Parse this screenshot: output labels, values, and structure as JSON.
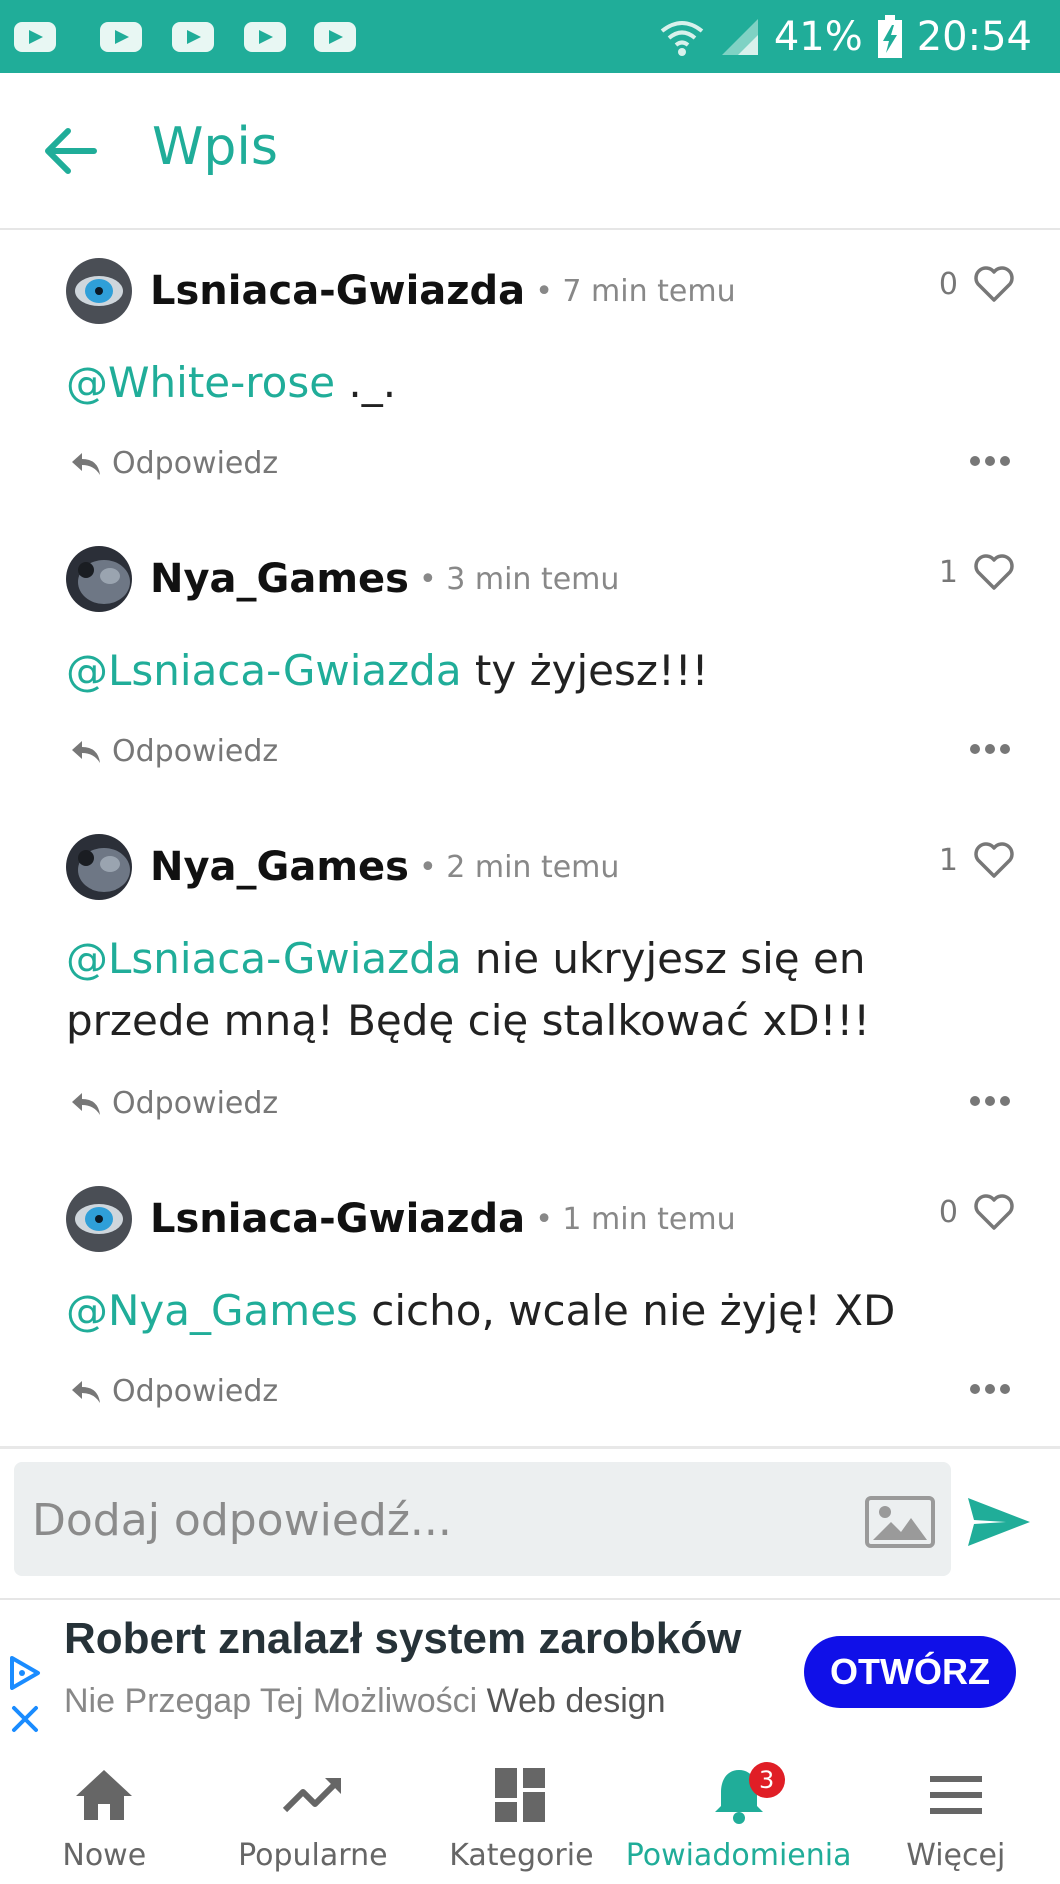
{
  "status_bar": {
    "battery": "41%",
    "time": "20:54",
    "notification_icons": [
      "youtube-icon",
      "youtube-icon",
      "youtube-icon",
      "youtube-icon",
      "youtube-icon"
    ]
  },
  "header": {
    "title": "Wpis"
  },
  "comments": [
    {
      "author": "Lsniaca-Gwiazda",
      "time": "• 7 min temu",
      "likes": "0",
      "mention": "@White-rose",
      "text": " ._.",
      "reply_label": "Odpowiedz"
    },
    {
      "author": "Nya_Games",
      "time": "• 3 min temu",
      "likes": "1",
      "mention": "@Lsniaca-Gwiazda",
      "text": " ty żyjesz!!!",
      "reply_label": "Odpowiedz"
    },
    {
      "author": "Nya_Games",
      "time": "• 2 min temu",
      "likes": "1",
      "mention": "@Lsniaca-Gwiazda",
      "text": " nie ukryjesz się en przede mną! Będę cię stalkować xD!!!",
      "reply_label": "Odpowiedz"
    },
    {
      "author": "Lsniaca-Gwiazda",
      "time": "• 1 min temu",
      "likes": "0",
      "mention": "@Nya_Games",
      "text": " cicho, wcale nie żyję! XD",
      "reply_label": "Odpowiedz"
    }
  ],
  "reply_input": {
    "placeholder": "Dodaj odpowiedź..."
  },
  "ad": {
    "title": "Robert znalazł system zarobków",
    "subtitle_main": "Nie Przegap Tej Możliwości",
    "subtitle_brand": "Web design",
    "cta": "OTWÓRZ"
  },
  "bottom_nav": {
    "items": [
      {
        "label": "Nowe",
        "icon": "home-icon"
      },
      {
        "label": "Popularne",
        "icon": "trending-icon"
      },
      {
        "label": "Kategorie",
        "icon": "dashboard-icon"
      },
      {
        "label": "Powiadomienia",
        "icon": "bell-icon",
        "badge": "3",
        "active": true
      },
      {
        "label": "Więcej",
        "icon": "menu-icon"
      }
    ]
  },
  "colors": {
    "accent": "#20ad99",
    "status_bar": "#20ad99",
    "badge": "#e01e26",
    "ad_button": "#1010e8"
  }
}
